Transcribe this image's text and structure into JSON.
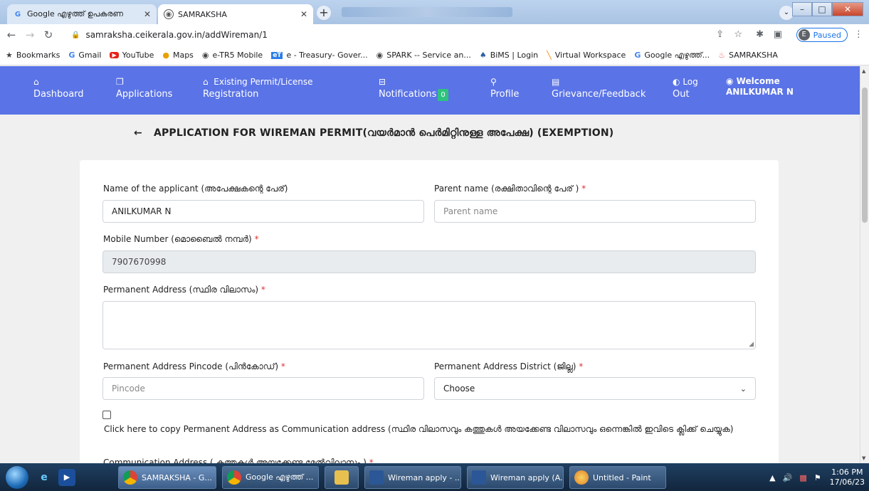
{
  "browser": {
    "tabs": [
      {
        "label": "Google എഴുത്ത് ഉപകരണ",
        "active": false
      },
      {
        "label": "SAMRAKSHA",
        "active": true
      }
    ],
    "url": "samraksha.ceikerala.gov.in/addWireman/1",
    "paused_label": "Paused",
    "profile_initial": "E",
    "bookmarks": [
      {
        "icon": "star-icon",
        "label": "Bookmarks"
      },
      {
        "icon": "google-icon",
        "label": "Gmail"
      },
      {
        "icon": "youtube-icon",
        "label": "YouTube"
      },
      {
        "icon": "maps-icon",
        "label": "Maps"
      },
      {
        "icon": "globe-icon",
        "label": "e-TR5 Mobile"
      },
      {
        "icon": "treasury-icon",
        "label": "e - Treasury- Gover..."
      },
      {
        "icon": "globe-icon",
        "label": "SPARK -- Service an..."
      },
      {
        "icon": "bims-icon",
        "label": "BiMS | Login"
      },
      {
        "icon": "workspace-icon",
        "label": "Virtual Workspace"
      },
      {
        "icon": "google-icon",
        "label": "Google എഴുത്ത്..."
      },
      {
        "icon": "samraksha-icon",
        "label": "SAMRAKSHA"
      }
    ]
  },
  "nav": {
    "items": [
      {
        "icon": "home-icon",
        "line1": "",
        "line2": "Dashboard"
      },
      {
        "icon": "applications-icon",
        "line1": "",
        "line2": "Applications"
      },
      {
        "icon": "permit-icon",
        "line1": "Existing Permit/License",
        "line2": "Registration"
      },
      {
        "icon": "notification-icon",
        "line1": "",
        "line2": "Notifications"
      },
      {
        "icon": "profile-icon",
        "line1": "",
        "line2": "Profile"
      },
      {
        "icon": "grievance-icon",
        "line1": "",
        "line2": "Grievance/Feedback"
      },
      {
        "icon": "logout-icon",
        "line1": "Log",
        "line2": "Out"
      }
    ],
    "notification_count": "0",
    "welcome_label": "Welcome",
    "user_name": "ANILKUMAR N"
  },
  "form": {
    "title": "APPLICATION FOR WIREMAN PERMIT(വയർമാൻ പെർമിറ്റിനുള്ള അപേക്ഷ) (EXEMPTION)",
    "applicant_label": "Name of the applicant (അപേക്ഷകന്റെ പേര്)",
    "applicant_value": "ANILKUMAR N",
    "parent_label": "Parent name (രക്ഷിതാവിന്റെ പേര് )",
    "parent_placeholder": "Parent name",
    "mobile_label": "Mobile Number (മൊബൈൽ നമ്പർ)",
    "mobile_value": "7907670998",
    "address_label": "Permanent Address (സ്ഥിര വിലാസം)",
    "pincode_label": "Permanent Address Pincode (പിൻകോഡ്)",
    "pincode_placeholder": "Pincode",
    "district_label": "Permanent Address District (ജില്ല)",
    "district_value": "Choose",
    "copy_label": "Click here to copy Permanent Address as Communication address (സ്ഥിര വിലാസവും കത്തുകൾ അയക്കേണ്ട വിലാസവും ഒന്നെങ്കിൽ ഇവിടെ ക്ലിക്ക് ചെയ്യുക)",
    "comm_label": "Communication Address ( കത്തുകൾ അയക്കേണ്ട മേൽവിലാസം )",
    "required_mark": "*"
  },
  "taskbar": {
    "buttons": [
      {
        "icon": "chrome-icon",
        "label": "SAMRAKSHA - G..."
      },
      {
        "icon": "chrome-icon",
        "label": "Google എഴുത്ത് ..."
      },
      {
        "icon": "explorer-folder-icon",
        "label": ""
      },
      {
        "icon": "word-icon",
        "label": "Wireman apply - ..."
      },
      {
        "icon": "word-icon",
        "label": "Wireman apply (A..."
      },
      {
        "icon": "paint-icon",
        "label": "Untitled - Paint"
      }
    ],
    "time": "1:06 PM",
    "date": "17/06/23"
  }
}
